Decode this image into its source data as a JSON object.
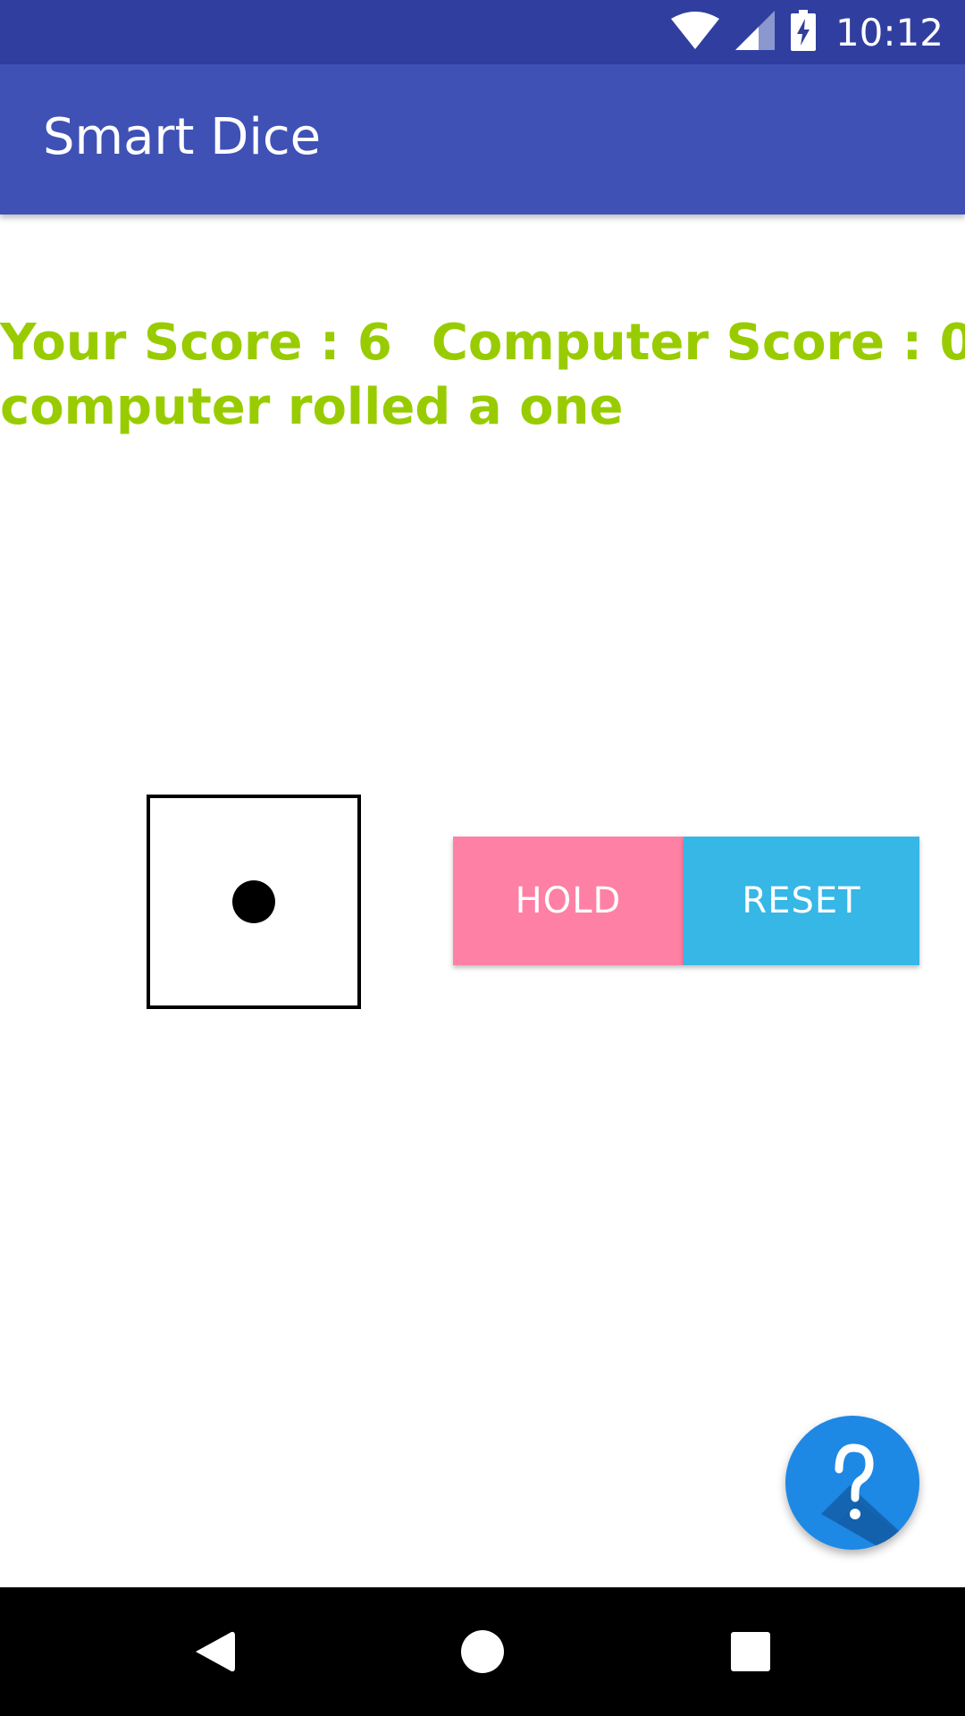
{
  "status_bar": {
    "time": "10:12",
    "icons": [
      "wifi-icon",
      "cell-signal-icon",
      "battery-charging-icon"
    ],
    "color": "#303f9f"
  },
  "app_bar": {
    "title": "Smart Dice",
    "color": "#3f51b5"
  },
  "game": {
    "your_score_text": "Your Score : 6",
    "computer_score_text": "Computer Score : 0",
    "status_message": "computer rolled a one",
    "text_color": "#99cc00",
    "dice_face": 1
  },
  "buttons": {
    "hold_label": "HOLD",
    "hold_color": "#ff80a5",
    "reset_label": "RESET",
    "reset_color": "#36b7e6"
  },
  "fab": {
    "icon": "help-icon",
    "color": "#1e88e5"
  },
  "nav_bar": {
    "icons": [
      "back-icon",
      "home-icon",
      "recents-icon"
    ]
  }
}
